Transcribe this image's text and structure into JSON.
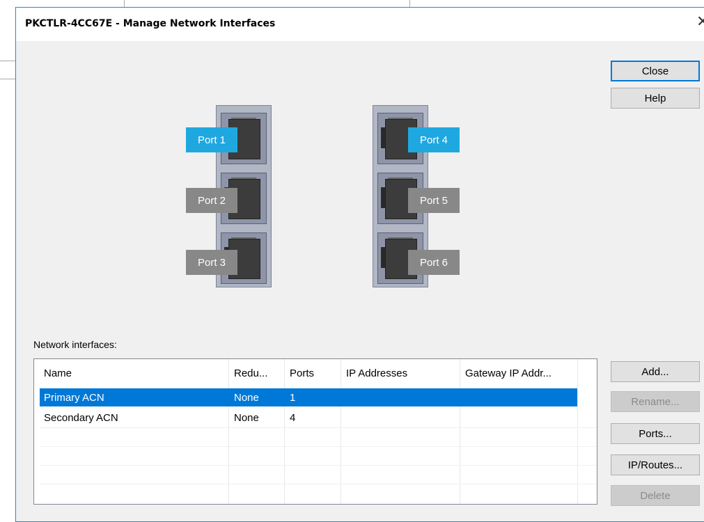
{
  "dialog": {
    "title": "PKCTLR-4CC67E - Manage Network Interfaces",
    "close_glyph": "✕"
  },
  "buttons": {
    "close": "Close",
    "help": "Help",
    "add": "Add...",
    "rename": "Rename...",
    "ports": "Ports...",
    "ip_routes": "IP/Routes...",
    "delete": "Delete"
  },
  "ports": [
    {
      "label": "Port 1",
      "active": true
    },
    {
      "label": "Port 2",
      "active": false
    },
    {
      "label": "Port 3",
      "active": false
    },
    {
      "label": "Port 4",
      "active": true
    },
    {
      "label": "Port 5",
      "active": false
    },
    {
      "label": "Port 6",
      "active": false
    }
  ],
  "interfaces": {
    "label": "Network interfaces:",
    "columns": [
      "Name",
      "Redu...",
      "Ports",
      "IP Addresses",
      "Gateway IP Addr..."
    ],
    "rows": [
      {
        "name": "Primary ACN",
        "redundancy": "None",
        "ports": "1",
        "ip": "",
        "gateway": "",
        "selected": true
      },
      {
        "name": "Secondary ACN",
        "redundancy": "None",
        "ports": "4",
        "ip": "",
        "gateway": "",
        "selected": false
      }
    ]
  },
  "colors": {
    "accent": "#0078d7",
    "port_active": "#1fa8e0",
    "port_inactive": "#888888"
  }
}
